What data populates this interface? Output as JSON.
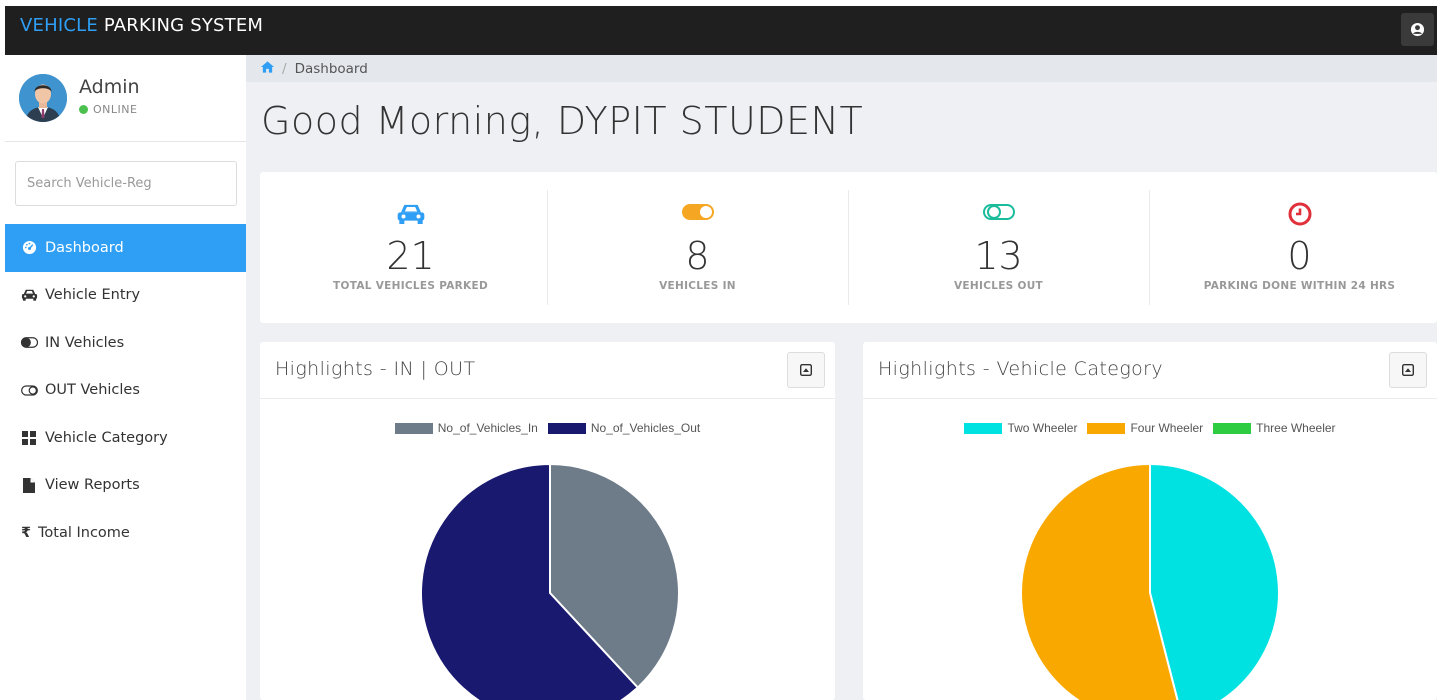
{
  "header": {
    "brand_part1": "VEHICLE",
    "brand_part2": "PARKING SYSTEM",
    "user_icon": "user-circle-icon"
  },
  "sidebar": {
    "user_name": "Admin",
    "status": "ONLINE",
    "search_placeholder": "Search Vehicle-Reg",
    "items": [
      {
        "label": "Dashboard",
        "icon": "dashboard-icon",
        "active": true
      },
      {
        "label": "Vehicle Entry",
        "icon": "car-icon"
      },
      {
        "label": "IN Vehicles",
        "icon": "toggle-on-icon"
      },
      {
        "label": "OUT Vehicles",
        "icon": "toggle-off-icon"
      },
      {
        "label": "Vehicle Category",
        "icon": "grid-icon"
      },
      {
        "label": "View Reports",
        "icon": "file-icon"
      },
      {
        "label": "Total Income",
        "icon": "rupee-icon"
      }
    ]
  },
  "breadcrumb": {
    "home_icon": "home-icon",
    "current": "Dashboard"
  },
  "greeting": "Good Morning, DYPIT STUDENT",
  "stats": [
    {
      "value": "21",
      "label": "TOTAL VEHICLES PARKED",
      "icon": "car-icon",
      "color": "#2f9ff5"
    },
    {
      "value": "8",
      "label": "VEHICLES IN",
      "icon": "toggle-on-icon",
      "color": "#f5a623"
    },
    {
      "value": "13",
      "label": "VEHICLES OUT",
      "icon": "toggle-off-icon",
      "color": "#1abc9c"
    },
    {
      "value": "0",
      "label": "PARKING DONE WITHIN 24 HRS",
      "icon": "clock-icon",
      "color": "#e0303a"
    }
  ],
  "panels": [
    {
      "title": "Highlights - IN | OUT",
      "button_icon": "caret-square-up-icon"
    },
    {
      "title": "Highlights - Vehicle Category",
      "button_icon": "caret-square-up-icon"
    }
  ],
  "chart_data": [
    {
      "type": "pie",
      "categories": [
        "No_of_Vehicles_In",
        "No_of_Vehicles_Out"
      ],
      "values": [
        8,
        13
      ],
      "colors": [
        "#6e7c8a",
        "#191970"
      ]
    },
    {
      "type": "pie",
      "categories": [
        "Two Wheeler",
        "Four Wheeler",
        "Three Wheeler"
      ],
      "values": [
        46,
        54,
        0
      ],
      "colors": [
        "#00e2e2",
        "#f9a800",
        "#2ecc40"
      ]
    }
  ]
}
